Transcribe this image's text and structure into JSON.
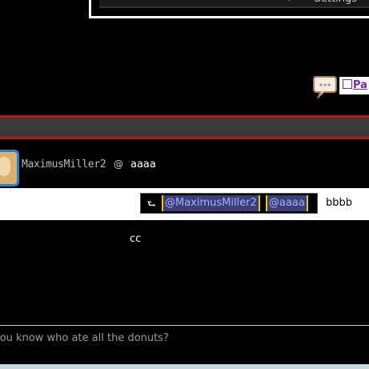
{
  "header": {
    "settings_arrow": "›",
    "settings_label": "Settings"
  },
  "toolbar": {
    "chat_icon": "speech-bubble-icon",
    "page_link_label": "Pa"
  },
  "message": {
    "username": "MaximusMiller2",
    "reply_symbol": "@",
    "text": "aaaa"
  },
  "reply": {
    "icon": "reply-arrow-icon",
    "mention_1": "@MaximusMiller2",
    "mention_2": "@aaaa",
    "text": "bbbb"
  },
  "followup": {
    "text": "cc"
  },
  "composer": {
    "placeholder": "you know who ate all the donuts?"
  },
  "colors": {
    "background": "#000000",
    "red_bar": "#c41414",
    "mention_bg": "#3a3f7a",
    "mention_border": "#f0c400",
    "avatar_border": "#2a7fd4",
    "link": "#6a2ca8"
  }
}
